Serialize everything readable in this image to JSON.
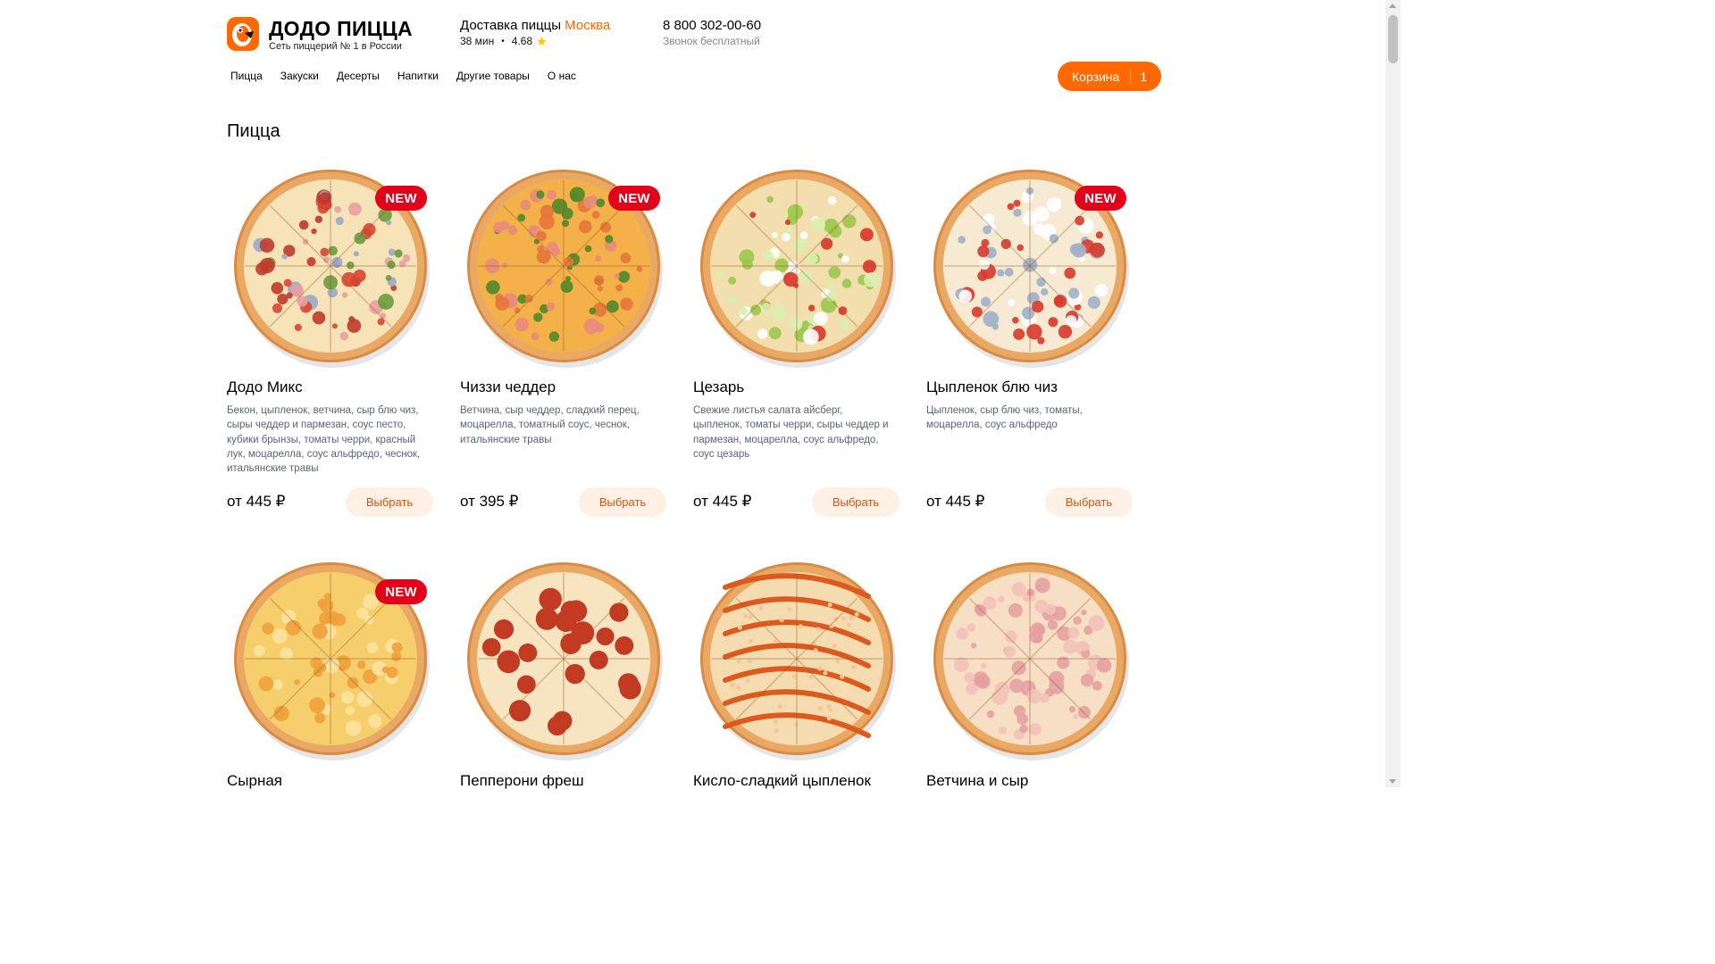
{
  "header": {
    "brand_title": "ДОДО ПИЦЦА",
    "brand_subtitle": "Сеть пиццерий № 1 в России",
    "delivery_label": "Доставка пиццы",
    "delivery_city": "Москва",
    "delivery_time": "38 мин",
    "rating": "4.68",
    "phone": "8 800 302-00-60",
    "phone_note": "Звонок бесплатный",
    "cart_label": "Корзина",
    "cart_count": "1"
  },
  "nav": {
    "items": [
      {
        "label": "Пицца"
      },
      {
        "label": "Закуски"
      },
      {
        "label": "Десерты"
      },
      {
        "label": "Напитки"
      },
      {
        "label": "Другие товары"
      },
      {
        "label": "О нас"
      }
    ]
  },
  "section": {
    "title": "Пицца"
  },
  "badge_label": "NEW",
  "choose_label": "Выбрать",
  "pizzas": [
    {
      "name": "Додо Микс",
      "desc": "Бекон, цыпленок, ветчина, сыр блю чиз, сыры чеддер и пармезан, соус песто, кубики брынзы, томаты черри, красный лук, моцарелла, соус альфредо, чеснок, итальянские травы",
      "price": "от 445 ₽",
      "is_new": true,
      "style": "mix"
    },
    {
      "name": "Чиззи чеддер",
      "desc": "Ветчина, сыр чеддер, сладкий перец, моцарелла, томатный соус, чеснок, итальянские травы",
      "price": "от 395 ₽",
      "is_new": true,
      "style": "cheddar"
    },
    {
      "name": "Цезарь",
      "desc": "Свежие листья салата айсберг, цыпленок, томаты черри, сыры чеддер и пармезан, моцарелла, соус альфредо, соус цезарь",
      "price": "от 445 ₽",
      "is_new": false,
      "style": "caesar"
    },
    {
      "name": "Цыпленок блю чиз",
      "desc": "Цыпленок, сыр блю чиз, томаты, моцарелла, соус альфредо",
      "price": "от 445 ₽",
      "is_new": true,
      "style": "bluecheese"
    },
    {
      "name": "Сырная",
      "desc": "",
      "price": "",
      "is_new": true,
      "style": "cheese"
    },
    {
      "name": "Пепперони фреш",
      "desc": "",
      "price": "",
      "is_new": false,
      "style": "pepperoni"
    },
    {
      "name": "Кисло-сладкий цыпленок",
      "desc": "",
      "price": "",
      "is_new": false,
      "style": "sweetsour"
    },
    {
      "name": "Ветчина и сыр",
      "desc": "",
      "price": "",
      "is_new": false,
      "style": "hamcheese"
    }
  ],
  "colors": {
    "brand": "#ff6900",
    "badge": "#e3001a",
    "button_bg": "#fff0e6",
    "button_text": "#d1570f",
    "star": "#ffc400"
  }
}
